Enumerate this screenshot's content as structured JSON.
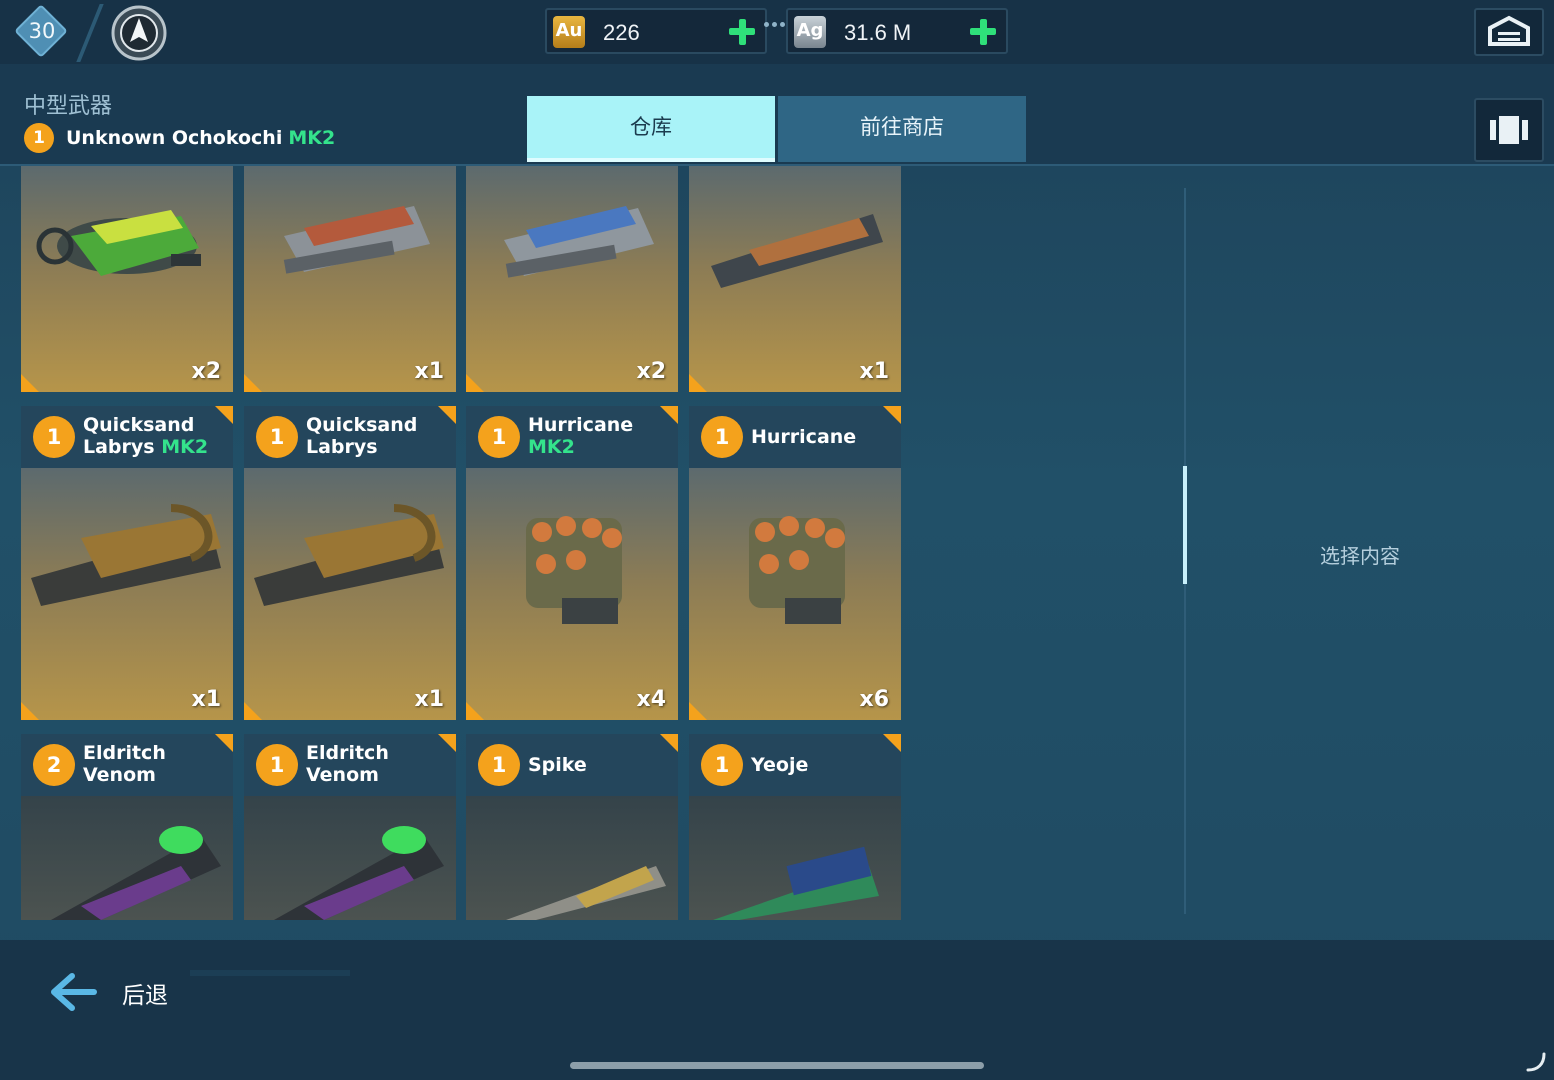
{
  "topbar": {
    "level": "30",
    "gold": {
      "icon_text": "Au",
      "value": "226"
    },
    "silver": {
      "icon_text": "Ag",
      "value": "31.6 M"
    }
  },
  "header": {
    "category": "中型武器",
    "selected_level": "1",
    "selected_name": "Unknown Ochokochi",
    "selected_mk": "MK2"
  },
  "tabs": {
    "warehouse": "仓库",
    "shop": "前往商店"
  },
  "cards_row1": [
    {
      "count": "x2"
    },
    {
      "count": "x1"
    },
    {
      "count": "x2"
    },
    {
      "count": "x1"
    }
  ],
  "cards_row2": [
    {
      "level": "1",
      "name1": "Quicksand",
      "name2": "Labrys",
      "mk": "MK2",
      "count": "x1"
    },
    {
      "level": "1",
      "name1": "Quicksand",
      "name2": "Labrys",
      "mk": "",
      "count": "x1"
    },
    {
      "level": "1",
      "name1": "Hurricane",
      "name2": "",
      "mk": "MK2",
      "count": "x4"
    },
    {
      "level": "1",
      "name1": "Hurricane",
      "name2": "",
      "mk": "",
      "count": "x6"
    }
  ],
  "cards_row3": [
    {
      "level": "2",
      "name1": "Eldritch",
      "name2": "Venom"
    },
    {
      "level": "1",
      "name1": "Eldritch",
      "name2": "Venom"
    },
    {
      "level": "1",
      "name1": "Spike",
      "name2": ""
    },
    {
      "level": "1",
      "name1": "Yeoje",
      "name2": ""
    }
  ],
  "side_panel": {
    "hint": "选择内容"
  },
  "footer": {
    "back_label": "后退"
  },
  "colors": {
    "accent_orange": "#f4a21c",
    "mk_green": "#34e38c",
    "tab_active": "#a9f3f8"
  }
}
